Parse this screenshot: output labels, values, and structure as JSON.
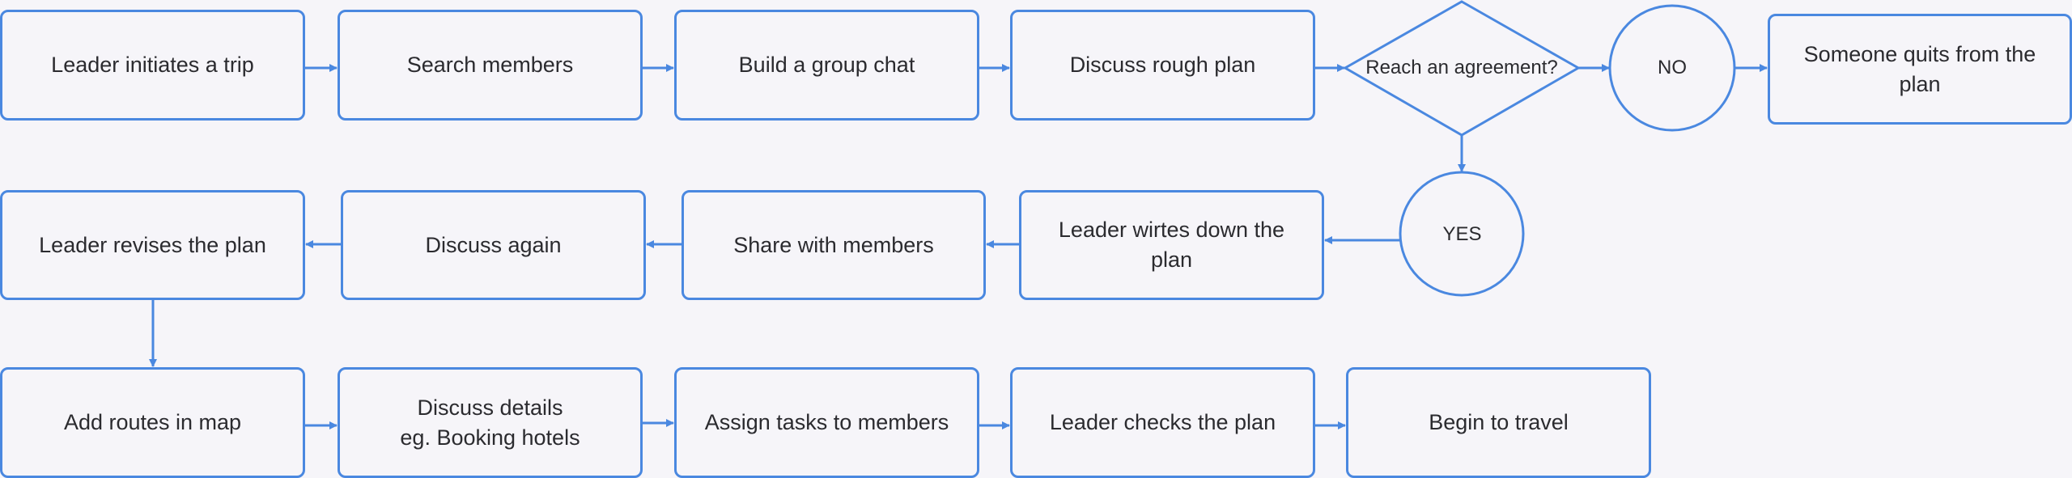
{
  "diagram": {
    "type": "flowchart",
    "colors": {
      "background": "#f6f5f9",
      "stroke": "#4a88e0",
      "text": "#2b2b2f"
    },
    "nodes": [
      {
        "id": "n1",
        "shape": "rounded-rect",
        "label": "Leader initiates a trip"
      },
      {
        "id": "n2",
        "shape": "rounded-rect",
        "label": "Search members"
      },
      {
        "id": "n3",
        "shape": "rounded-rect",
        "label": "Build a group chat"
      },
      {
        "id": "n4",
        "shape": "rounded-rect",
        "label": "Discuss rough plan"
      },
      {
        "id": "n5",
        "shape": "diamond",
        "label": "Reach an agreement?"
      },
      {
        "id": "n6",
        "shape": "circle",
        "label": "NO"
      },
      {
        "id": "n7",
        "shape": "rounded-rect",
        "label": "Someone quits from the plan"
      },
      {
        "id": "n8",
        "shape": "circle",
        "label": "YES"
      },
      {
        "id": "n9",
        "shape": "rounded-rect",
        "label": "Leader wirtes down the plan"
      },
      {
        "id": "n10",
        "shape": "rounded-rect",
        "label": "Share with members"
      },
      {
        "id": "n11",
        "shape": "rounded-rect",
        "label": "Discuss again"
      },
      {
        "id": "n12",
        "shape": "rounded-rect",
        "label": "Leader revises the plan"
      },
      {
        "id": "n13",
        "shape": "rounded-rect",
        "label": "Add routes in map"
      },
      {
        "id": "n14",
        "shape": "rounded-rect",
        "label": "Discuss details\neg. Booking hotels"
      },
      {
        "id": "n15",
        "shape": "rounded-rect",
        "label": "Assign tasks to members"
      },
      {
        "id": "n16",
        "shape": "rounded-rect",
        "label": "Leader checks the plan"
      },
      {
        "id": "n17",
        "shape": "rounded-rect",
        "label": "Begin to travel"
      }
    ],
    "edges": [
      {
        "from": "n1",
        "to": "n2"
      },
      {
        "from": "n2",
        "to": "n3"
      },
      {
        "from": "n3",
        "to": "n4"
      },
      {
        "from": "n4",
        "to": "n5"
      },
      {
        "from": "n5",
        "to": "n6"
      },
      {
        "from": "n6",
        "to": "n7"
      },
      {
        "from": "n5",
        "to": "n8"
      },
      {
        "from": "n8",
        "to": "n9"
      },
      {
        "from": "n9",
        "to": "n10"
      },
      {
        "from": "n10",
        "to": "n11"
      },
      {
        "from": "n11",
        "to": "n12"
      },
      {
        "from": "n12",
        "to": "n13"
      },
      {
        "from": "n13",
        "to": "n14"
      },
      {
        "from": "n14",
        "to": "n15"
      },
      {
        "from": "n15",
        "to": "n16"
      },
      {
        "from": "n16",
        "to": "n17"
      }
    ]
  }
}
